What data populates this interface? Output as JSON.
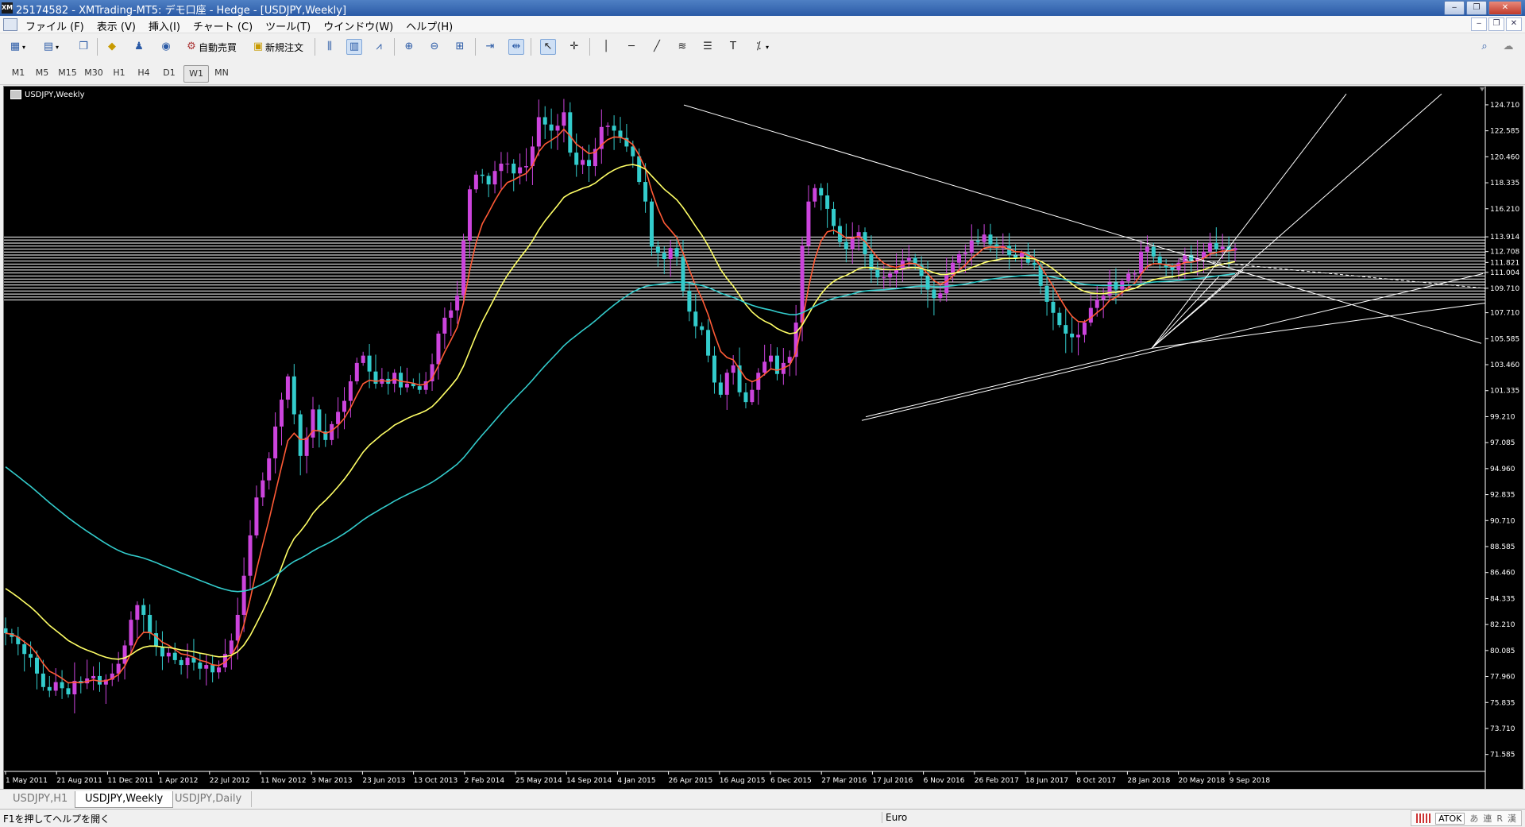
{
  "window": {
    "logo_text": "XM",
    "title": "25174582 - XMTrading-MT5: デモ口座 - Hedge - [USDJPY,Weekly]",
    "controls": [
      "‒",
      "❐",
      "✕"
    ]
  },
  "menu": {
    "items": [
      "ファイル (F)",
      "表示 (V)",
      "挿入(I)",
      "チャート (C)",
      "ツール(T)",
      "ウインドウ(W)",
      "ヘルプ(H)"
    ],
    "mdi_controls": [
      "‒",
      "❐",
      "✕"
    ]
  },
  "toolbar": {
    "auto_trade_label": "自動売買",
    "new_order_label": "新規注文",
    "icons": [
      "new-chart-icon",
      "profiles-icon",
      "market-watch-icon",
      "navigator-icon",
      "data-window-icon",
      "signals-icon",
      "auto-trading-icon",
      "new-order-icon",
      "bar-chart-icon",
      "candlestick-icon",
      "line-chart-icon",
      "zoom-in-icon",
      "zoom-out-icon",
      "tile-windows-icon",
      "autoscroll-icon",
      "chart-shift-icon",
      "cursor-icon",
      "crosshair-icon",
      "vertical-line-icon",
      "horizontal-line-icon",
      "trendline-icon",
      "fibonacci-icon",
      "channel-icon",
      "text-icon",
      "shapes-icon",
      "search-icon",
      "chat-icon"
    ]
  },
  "timeframes": {
    "items": [
      "M1",
      "M5",
      "M15",
      "M30",
      "H1",
      "H4",
      "D1",
      "W1",
      "MN"
    ],
    "active": "W1"
  },
  "chart_label": "USDJPY,Weekly",
  "chart_data": {
    "type": "candlestick",
    "symbol": "USDJPY",
    "timeframe": "Weekly",
    "x_tick_labels": [
      "1 May 2011",
      "21 Aug 2011",
      "11 Dec 2011",
      "1 Apr 2012",
      "22 Jul 2012",
      "11 Nov 2012",
      "3 Mar 2013",
      "23 Jun 2013",
      "13 Oct 2013",
      "2 Feb 2014",
      "25 May 2014",
      "14 Sep 2014",
      "4 Jan 2015",
      "26 Apr 2015",
      "16 Aug 2015",
      "6 Dec 2015",
      "27 Mar 2016",
      "17 Jul 2016",
      "6 Nov 2016",
      "26 Feb 2017",
      "18 Jun 2017",
      "8 Oct 2017",
      "28 Jan 2018",
      "20 May 2018",
      "9 Sep 2018"
    ],
    "y_tick_labels": [
      "124.710",
      "122.585",
      "120.460",
      "118.335",
      "116.210",
      "113.914",
      "112.708",
      "111.821",
      "111.004",
      "109.710",
      "107.710",
      "105.585",
      "103.460",
      "101.335",
      "99.210",
      "97.085",
      "94.960",
      "92.835",
      "90.710",
      "88.585",
      "86.460",
      "84.335",
      "82.210",
      "80.085",
      "77.960",
      "75.835",
      "73.710",
      "71.585"
    ],
    "ylim": [
      70.2,
      126.2
    ],
    "price_path_weekly_close": [
      81.5,
      81.2,
      80.6,
      79.8,
      79.5,
      78.2,
      77.1,
      76.8,
      77.5,
      77.0,
      76.5,
      77.6,
      77.4,
      77.8,
      78.0,
      77.3,
      77.7,
      78.2,
      79.0,
      80.5,
      82.6,
      83.8,
      83.0,
      81.5,
      80.4,
      79.6,
      79.9,
      79.3,
      78.9,
      79.5,
      79.1,
      78.6,
      78.9,
      78.3,
      78.7,
      79.8,
      80.9,
      83.0,
      86.2,
      89.5,
      92.6,
      94.0,
      95.8,
      98.4,
      100.6,
      102.5,
      99.4,
      96.0,
      97.5,
      99.8,
      98.0,
      97.3,
      98.6,
      99.6,
      100.5,
      102.1,
      103.6,
      104.2,
      102.9,
      101.9,
      102.3,
      101.9,
      102.8,
      101.6,
      101.9,
      101.7,
      101.4,
      102.1,
      103.5,
      106.0,
      107.3,
      107.9,
      109.1,
      113.6,
      117.8,
      119.0,
      118.9,
      118.2,
      119.3,
      119.9,
      119.9,
      119.1,
      119.6,
      119.7,
      121.3,
      123.7,
      123.1,
      122.6,
      123.0,
      124.1,
      120.8,
      119.8,
      120.2,
      119.7,
      121.1,
      122.9,
      123.0,
      122.6,
      122.0,
      121.3,
      120.5,
      118.4,
      116.8,
      113.1,
      112.6,
      112.1,
      113.0,
      112.3,
      109.5,
      107.8,
      106.6,
      106.3,
      104.2,
      102.0,
      101.0,
      102.8,
      103.4,
      101.2,
      100.4,
      101.4,
      102.8,
      103.7,
      104.2,
      102.7,
      103.6,
      104.1,
      106.9,
      113.2,
      116.8,
      117.9,
      117.3,
      116.2,
      114.8,
      113.5,
      112.9,
      113.8,
      114.3,
      112.5,
      111.2,
      110.6,
      110.6,
      110.9,
      111.2,
      112.0,
      112.2,
      111.6,
      110.7,
      109.6,
      108.9,
      109.3,
      110.8,
      111.8,
      112.5,
      112.6,
      113.6,
      113.5,
      114.1,
      113.3,
      113.0,
      113.2,
      112.4,
      112.2,
      112.6,
      111.8,
      111.6,
      109.9,
      108.6,
      107.7,
      106.7,
      106.0,
      105.7,
      105.9,
      106.9,
      108.1,
      108.8,
      109.1,
      110.2,
      109.6,
      110.3,
      110.9,
      110.9,
      112.7,
      113.1,
      112.3,
      111.7,
      111.4,
      111.2,
      111.8,
      112.4,
      111.9,
      112.2,
      112.7,
      113.4,
      112.9,
      113.1,
      112.8,
      113.0
    ],
    "moving_averages": [
      {
        "name": "",
        "color": "#ff5a36"
      },
      {
        "name": "",
        "color": "#ffff66"
      },
      {
        "name": "",
        "color": "#33cccc"
      }
    ],
    "grid": false
  },
  "tabs": {
    "items": [
      "USDJPY,H1",
      "USDJPY,Weekly",
      "USDJPY,Daily"
    ],
    "active": "USDJPY,Weekly"
  },
  "status": {
    "help_text": "F1を押してヘルプを開く",
    "profile": "Euro",
    "ime": [
      "ATOK",
      "あ",
      "連",
      "R",
      "漢"
    ]
  },
  "colors": {
    "background": "#000000",
    "bull_candle": "#cc44dd",
    "bear_candle": "#33cccc",
    "drawn_lines": "#ffffff"
  }
}
